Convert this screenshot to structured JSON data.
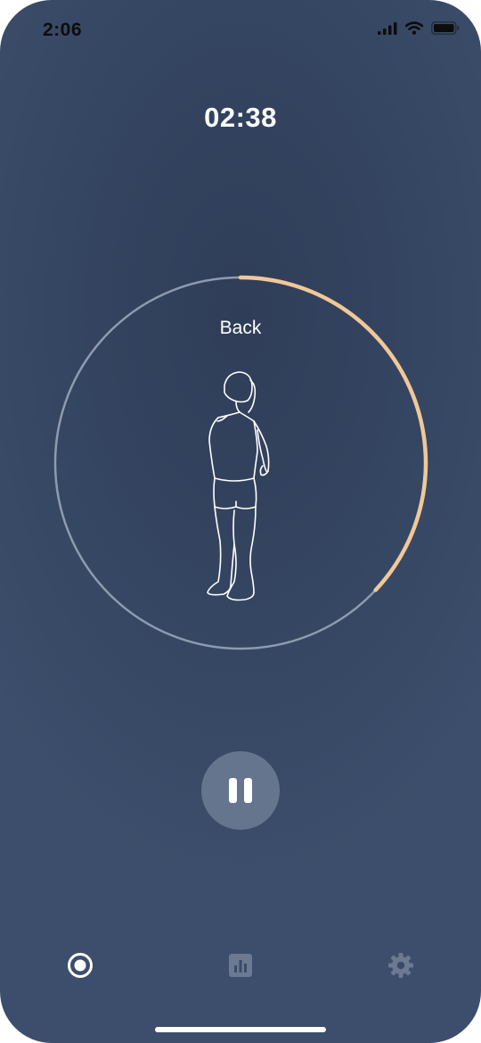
{
  "status_bar": {
    "time": "2:06",
    "icons": [
      "cellular-signal-icon",
      "wifi-icon",
      "battery-icon"
    ]
  },
  "session": {
    "timer": "02:38",
    "exercise_name": "Back",
    "progress_fraction": 0.37
  },
  "controls": {
    "primary_action": "pause-icon"
  },
  "tab_bar": {
    "tabs": [
      {
        "icon": "record-icon",
        "active": true
      },
      {
        "icon": "bar-chart-icon",
        "active": false
      },
      {
        "icon": "gear-icon",
        "active": false
      }
    ]
  },
  "colors": {
    "background": "#354662",
    "accent": "#f0c898",
    "ring_track": "#8e9bb0",
    "pause_button": "#66758e",
    "inactive_tab": "#6b7a92"
  }
}
